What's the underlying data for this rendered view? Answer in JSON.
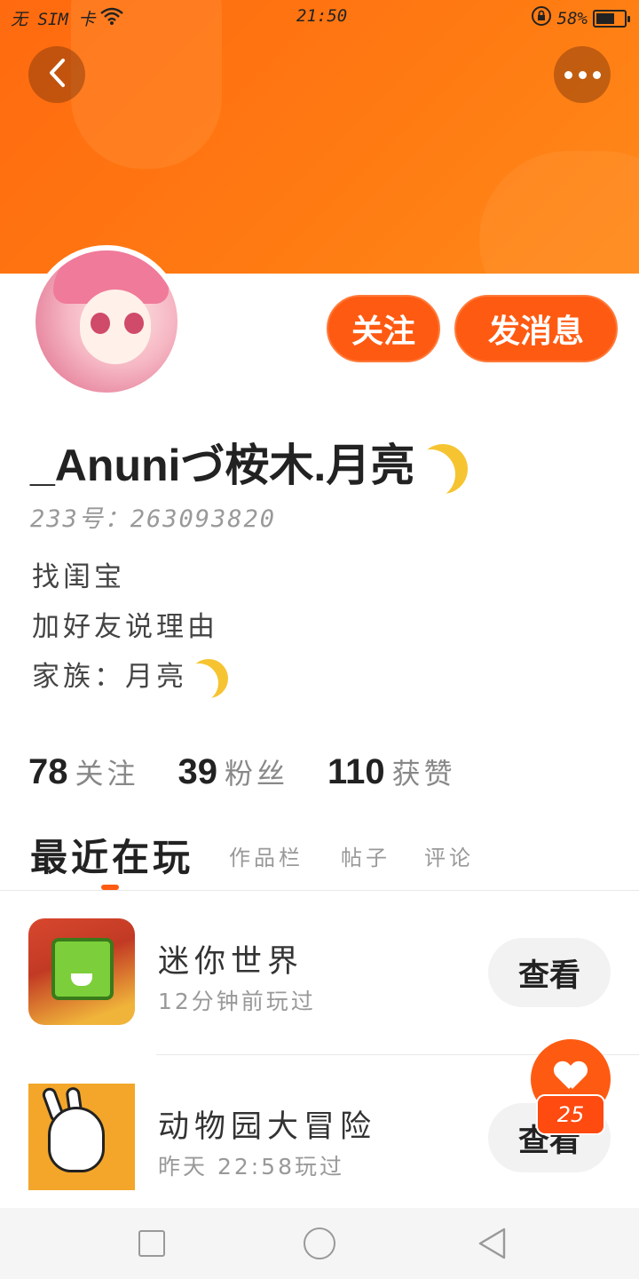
{
  "status_bar": {
    "sim": "无 SIM 卡",
    "time": "21:50",
    "battery": "58%"
  },
  "profile": {
    "username": "_Anuniづ桉木.月亮",
    "uid": "233号：263093820",
    "bio": [
      "找闺宝",
      "加好友说理由",
      "家族：月亮"
    ],
    "follow_label": "关注",
    "message_label": "发消息"
  },
  "stats": {
    "following": {
      "num": "78",
      "label": "关注"
    },
    "fans": {
      "num": "39",
      "label": "粉丝"
    },
    "likes": {
      "num": "110",
      "label": "获赞"
    }
  },
  "tabs": [
    "最近在玩",
    "作品栏",
    "帖子",
    "评论"
  ],
  "games": [
    {
      "name": "迷你世界",
      "time": "12分钟前玩过",
      "button": "查看"
    },
    {
      "name": "动物园大冒险",
      "time": "昨天 22:58玩过",
      "button": "查看"
    }
  ],
  "fab": {
    "count": "25"
  },
  "colors": {
    "accent": "#ff5a12",
    "header": "#ff7a12"
  },
  "icons": [
    "back-icon",
    "more-icon",
    "heart-icon",
    "nav-recent-icon",
    "nav-home-icon",
    "nav-back-icon"
  ]
}
